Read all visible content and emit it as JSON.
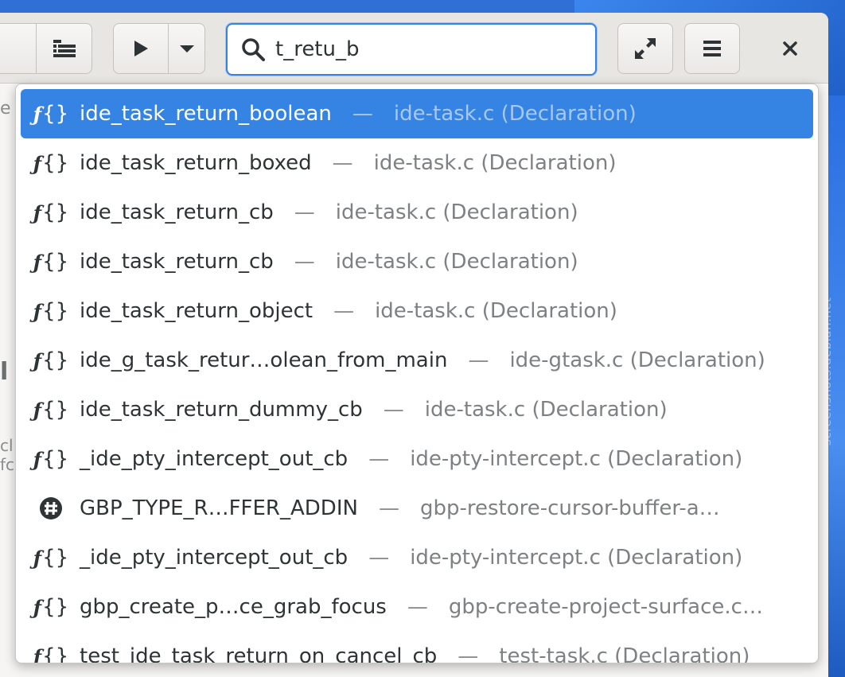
{
  "search": {
    "value": "t_retu_b"
  },
  "background": {
    "watermark": "screenshots.debian.net"
  },
  "sidebar": {
    "partial_texts": [
      "e",
      "l",
      "cl",
      "fc"
    ]
  },
  "results": [
    {
      "name": "ide_task_return_boolean",
      "location": "ide-task.c (Declaration)",
      "kind": "function-icon",
      "selected": true
    },
    {
      "name": "ide_task_return_boxed",
      "location": "ide-task.c (Declaration)",
      "kind": "function-icon"
    },
    {
      "name": "ide_task_return_cb",
      "location": "ide-task.c (Declaration)",
      "kind": "function-icon"
    },
    {
      "name": "ide_task_return_cb",
      "location": "ide-task.c (Declaration)",
      "kind": "function-icon"
    },
    {
      "name": "ide_task_return_object",
      "location": "ide-task.c (Declaration)",
      "kind": "function-icon"
    },
    {
      "name": "ide_g_task_retur…olean_from_main",
      "location": "ide-gtask.c (Declaration)",
      "kind": "function-icon"
    },
    {
      "name": "ide_task_return_dummy_cb",
      "location": "ide-task.c (Declaration)",
      "kind": "function-icon"
    },
    {
      "name": "_ide_pty_intercept_out_cb",
      "location": "ide-pty-intercept.c (Declaration)",
      "kind": "function-icon"
    },
    {
      "name": "GBP_TYPE_R…FFER_ADDIN",
      "location": "gbp-restore-cursor-buffer-a…",
      "kind": "macro-icon"
    },
    {
      "name": "_ide_pty_intercept_out_cb",
      "location": "ide-pty-intercept.c (Declaration)",
      "kind": "function-icon"
    },
    {
      "name": "gbp_create_p…ce_grab_focus",
      "location": "gbp-create-project-surface.c…",
      "kind": "function-icon"
    },
    {
      "name": "test_ide_task_return_on_cancel_cb",
      "location": "test-task.c (Declaration)",
      "kind": "function-icon"
    }
  ],
  "separator": "—",
  "colors": {
    "accent": "#3584e4",
    "text": "#2e3436",
    "dim": "#7d8183"
  }
}
